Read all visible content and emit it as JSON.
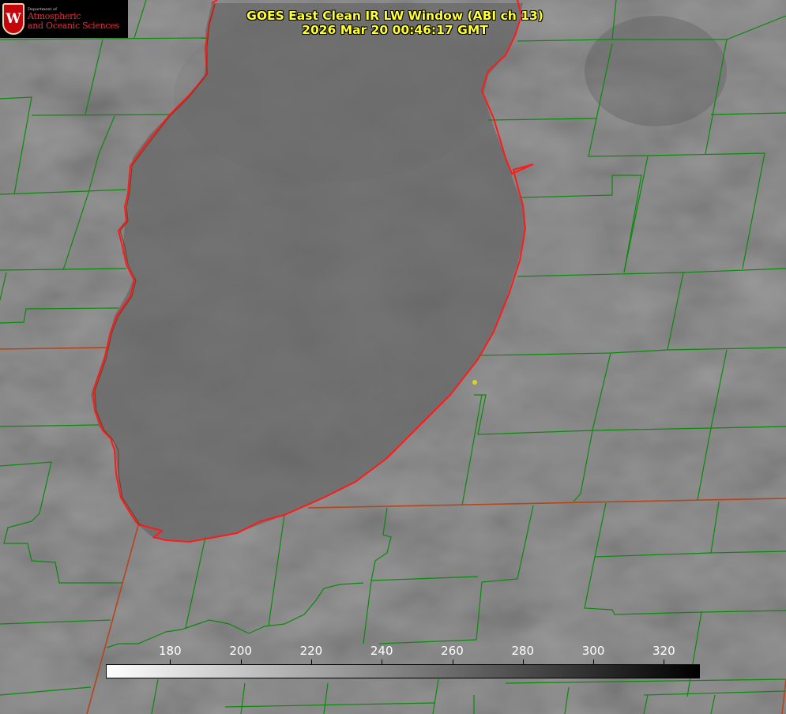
{
  "logo": {
    "department": "Department of",
    "line1": "Atmospheric",
    "line2": "and Oceanic Sciences",
    "shield_letter": "W",
    "icon": "uw-shield-icon"
  },
  "title": {
    "line1": "GOES East Clean IR LW Window (ABI ch 13)",
    "line2": "2026 Mar 20 00:46:17 GMT"
  },
  "colorbar": {
    "min": 162,
    "max": 330,
    "color_start": "#ffffff",
    "color_end": "#000000",
    "ticks": [
      "180",
      "200",
      "220",
      "240",
      "260",
      "280",
      "300",
      "320"
    ]
  },
  "map_colors": {
    "county_borders": "#0a8a0a",
    "state_borders": "#b5451b",
    "lake_shoreline": "#ff1a1a",
    "marker": "#e0d020",
    "text": "#ffff33"
  }
}
